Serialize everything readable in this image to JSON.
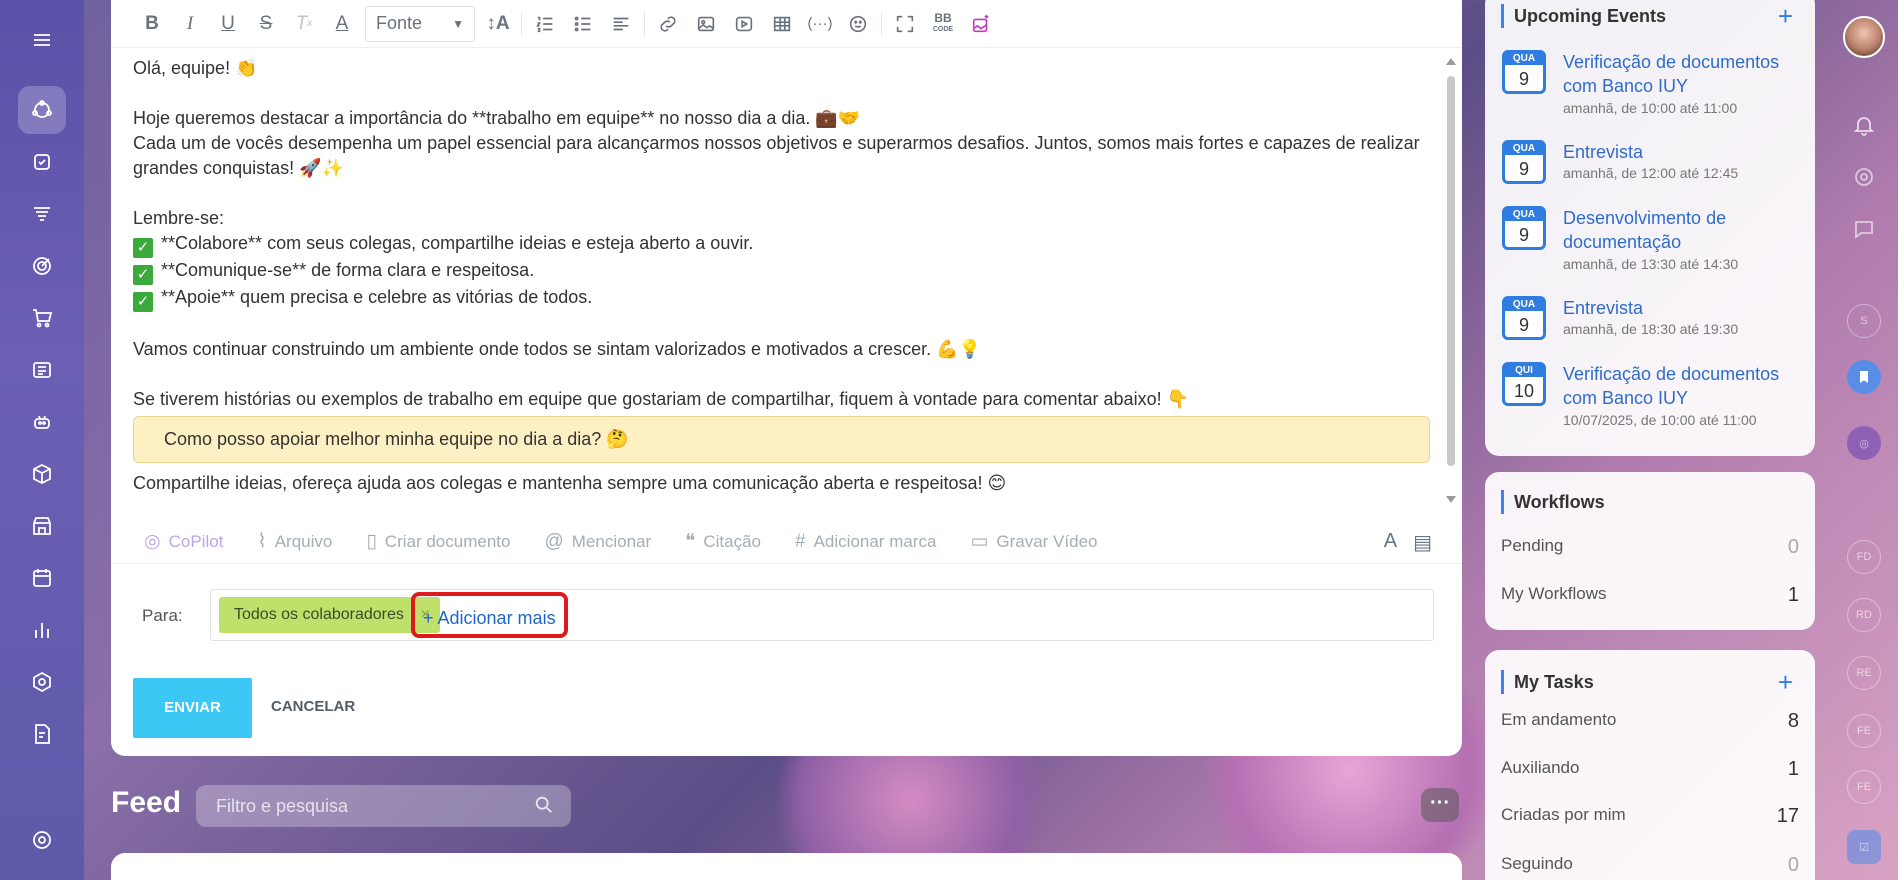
{
  "toolbar": {
    "font_select": "Fonte",
    "bbcode_label": "BB"
  },
  "editor": {
    "lines": [
      "Olá, equipe! 👏",
      "",
      "Hoje queremos destacar a importância do **trabalho em equipe** no nosso dia a dia. 💼🤝",
      "Cada um de vocês desempenha um papel essencial para alcançarmos nossos objetivos e superarmos desafios. Juntos, somos mais fortes e capazes de realizar grandes conquistas! 🚀✨",
      "",
      "Lembre-se:"
    ],
    "checklist": [
      "**Colabore** com seus colegas, compartilhe ideias e esteja aberto a ouvir.",
      "**Comunique-se** de forma clara e respeitosa.",
      "**Apoie** quem precisa e celebre as vitórias de todos."
    ],
    "para_continue": "Vamos continuar construindo um ambiente onde todos se sintam valorizados e motivados a crescer. 💪💡",
    "para_stories": "Se tiverem histórias ou exemplos de trabalho em equipe que gostariam de compartilhar, fiquem à vontade para comentar abaixo! 👇",
    "quote": "Como posso apoiar melhor minha equipe no dia a dia? 🤔",
    "closing": "Compartilhe ideias, ofereça ajuda aos colegas e mantenha sempre uma comunicação aberta e respeitosa! 😊"
  },
  "actions": {
    "copilot": "CoPilot",
    "file": "Arquivo",
    "create_doc": "Criar documento",
    "mention": "Mencionar",
    "quote": "Citação",
    "tag": "Adicionar marca",
    "video": "Gravar Vídeo"
  },
  "recipients": {
    "label": "Para:",
    "tag": "Todos os colaboradores",
    "add_more": "+ Adicionar mais"
  },
  "buttons": {
    "send": "ENVIAR",
    "cancel": "CANCELAR"
  },
  "feed": {
    "title": "Feed",
    "search_placeholder": "Filtro e pesquisa",
    "more": "···"
  },
  "events": {
    "title": "Upcoming Events",
    "items": [
      {
        "dow": "QUA",
        "day": "9",
        "title": "Verificação de documentos com Banco IUY",
        "time": "amanhã, de 10:00 até 11:00"
      },
      {
        "dow": "QUA",
        "day": "9",
        "title": "Entrevista",
        "time": "amanhã, de 12:00 até 12:45"
      },
      {
        "dow": "QUA",
        "day": "9",
        "title": "Desenvolvimento de documentação",
        "time": "amanhã, de 13:30 até 14:30"
      },
      {
        "dow": "QUA",
        "day": "9",
        "title": "Entrevista",
        "time": "amanhã, de 18:30 até 19:30"
      },
      {
        "dow": "QUI",
        "day": "10",
        "title": "Verificação de documentos com Banco IUY",
        "time": "10/07/2025, de 10:00 até 11:00"
      }
    ]
  },
  "workflows": {
    "title": "Workflows",
    "rows": [
      {
        "label": "Pending",
        "count": "0"
      },
      {
        "label": "My Workflows",
        "count": "1"
      }
    ]
  },
  "tasks": {
    "title": "My Tasks",
    "rows": [
      {
        "label": "Em andamento",
        "count": "8"
      },
      {
        "label": "Auxiliando",
        "count": "1"
      },
      {
        "label": "Criadas por mim",
        "count": "17"
      },
      {
        "label": "Seguindo",
        "count": "0"
      }
    ]
  },
  "far_right": {
    "initials": [
      "S",
      "FD",
      "RD",
      "RE",
      "FE",
      "FE"
    ]
  },
  "colors": {
    "accent_blue": "#2f7de1",
    "send_button": "#3bc8f5",
    "tag_green": "#bfe06b",
    "highlight_red": "#e0191c"
  }
}
